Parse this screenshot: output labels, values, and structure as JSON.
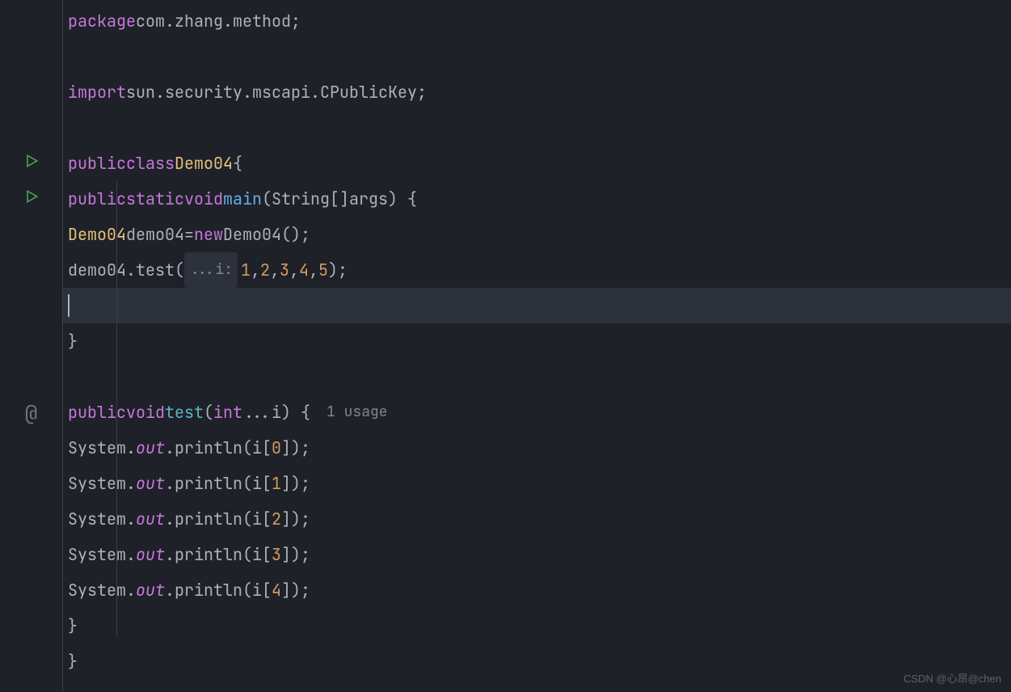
{
  "package": {
    "kw": "package",
    "name": "com.zhang.method"
  },
  "import": {
    "kw": "import",
    "name": "sun.security.mscapi.CPublicKey"
  },
  "class": {
    "kw_public": "public",
    "kw_class": "class",
    "name": "Demo04"
  },
  "main": {
    "kw_public": "public",
    "kw_static": "static",
    "kw_void": "void",
    "name": "main",
    "param_type": "String[]",
    "param_name": "args"
  },
  "body": {
    "class_name": "Demo04",
    "var_name": "demo04",
    "kw_new": "new",
    "new_class": "Demo04",
    "call_obj": "demo04",
    "call_method": "test",
    "param_hint": "...i:",
    "args": [
      "1",
      "2",
      "3",
      "4",
      "5"
    ]
  },
  "test": {
    "kw_public": "public",
    "kw_void": "void",
    "name": "test",
    "param_type": "int",
    "param_varargs": "...i",
    "usage": "1 usage"
  },
  "prints": [
    {
      "obj": "System",
      "field": "out",
      "method": "println",
      "var": "i",
      "idx": "0"
    },
    {
      "obj": "System",
      "field": "out",
      "method": "println",
      "var": "i",
      "idx": "1"
    },
    {
      "obj": "System",
      "field": "out",
      "method": "println",
      "var": "i",
      "idx": "2"
    },
    {
      "obj": "System",
      "field": "out",
      "method": "println",
      "var": "i",
      "idx": "3"
    },
    {
      "obj": "System",
      "field": "out",
      "method": "println",
      "var": "i",
      "idx": "4"
    }
  ],
  "watermark": "CSDN @心昂@chen"
}
